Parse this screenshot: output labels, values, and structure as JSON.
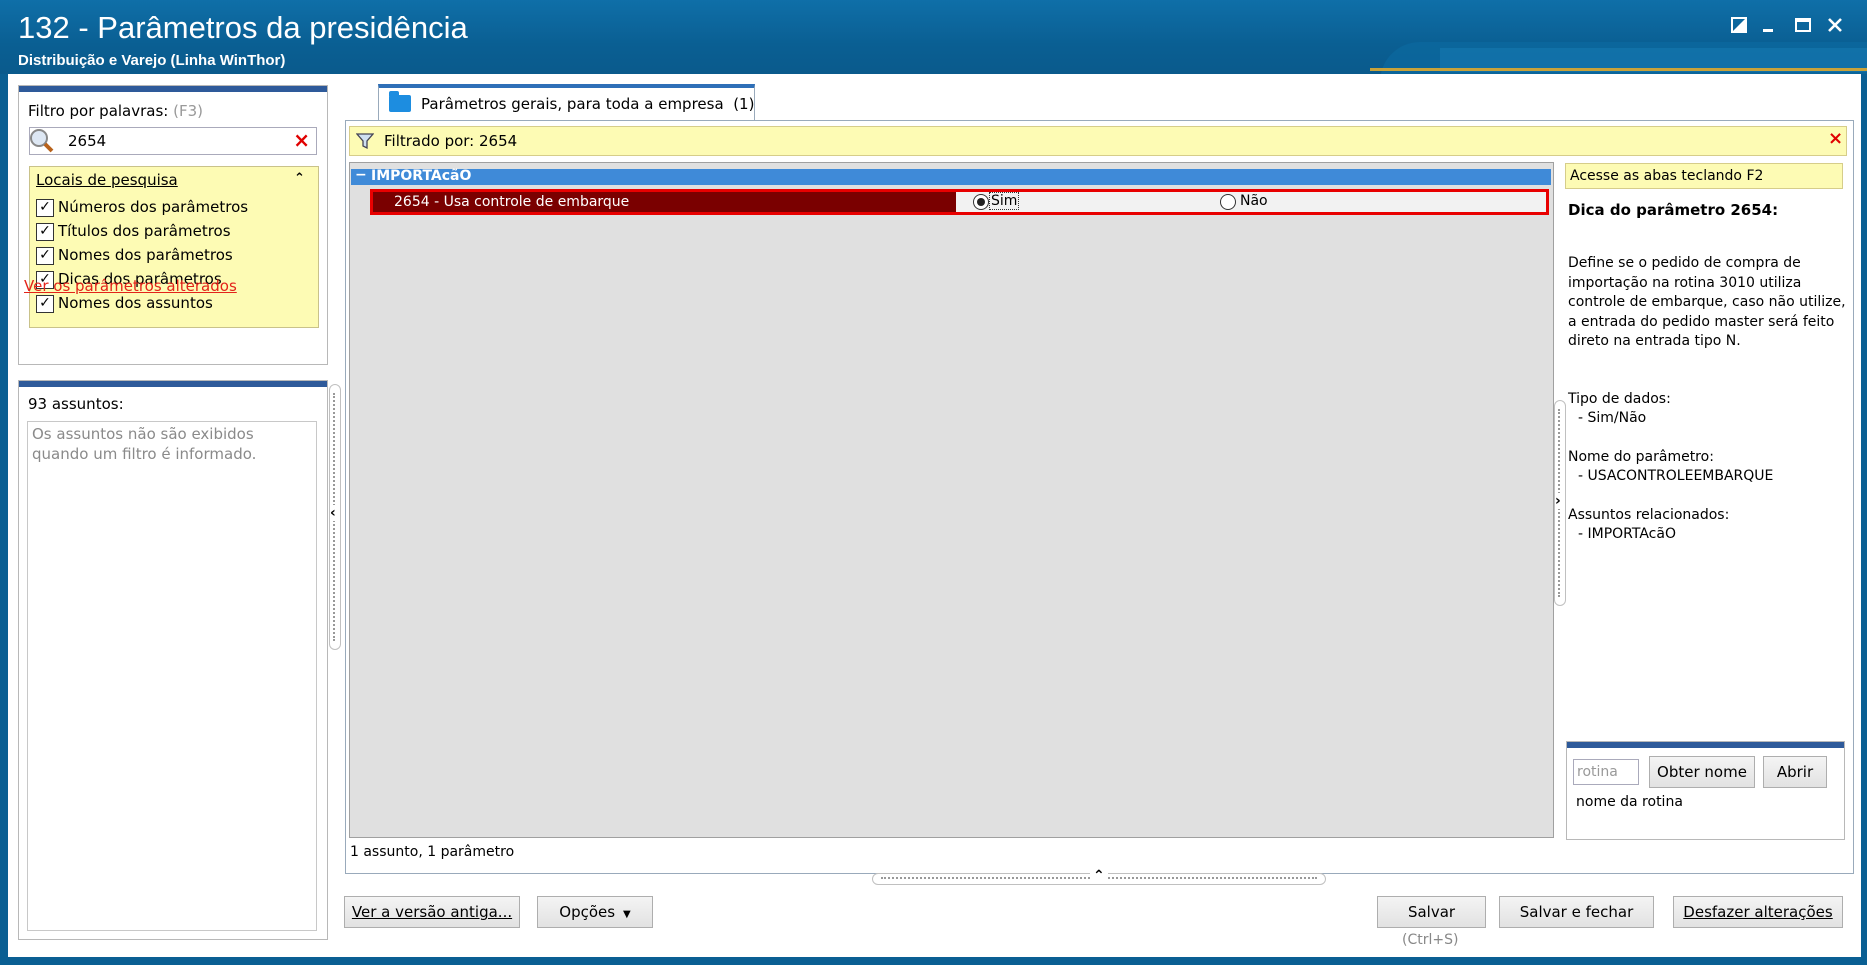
{
  "window": {
    "title": "132 - Parâmetros da presidência",
    "subtitle": "Distribuição e Varejo (Linha WinThor)",
    "icons": [
      "restore-icon",
      "minimize-icon",
      "maximize-icon",
      "close-icon"
    ]
  },
  "filter": {
    "label": "Filtro por palavras:",
    "shortcut": "(F3)",
    "value": "2654",
    "clear_icon": "×",
    "locais_title": "Locais de pesquisa",
    "options": [
      {
        "label": "Números dos parâmetros",
        "checked": true
      },
      {
        "label": "Títulos dos parâmetros",
        "checked": true
      },
      {
        "label": "Nomes dos parâmetros",
        "checked": true
      },
      {
        "label": "Dicas dos parâmetros",
        "checked": true
      },
      {
        "label": "Nomes dos assuntos",
        "checked": true
      }
    ],
    "changed_link": "Ver os parâmetros alterados"
  },
  "subjects": {
    "count_label": "93 assuntos:",
    "message": "Os assuntos não são exibidos quando um filtro é informado."
  },
  "tab": {
    "label": "Parâmetros gerais, para toda a empresa",
    "count": "(1)"
  },
  "filtered": {
    "label": "Filtrado por: 2654",
    "close": "×"
  },
  "grid": {
    "group": "IMPORTAcãO",
    "group_toggle": "−",
    "row": {
      "name": "2654 - Usa controle de embarque",
      "option_yes": "Sim",
      "option_no": "Não",
      "selected": "Sim"
    },
    "status": "1 assunto, 1 parâmetro"
  },
  "hint": {
    "tab_tip": "Acesse as abas teclando F2",
    "title": "Dica do parâmetro 2654:",
    "description": "Define se o pedido de compra de importação na rotina  3010 utiliza controle de embarque, caso não utilize, a entrada do pedido master será feito direto na entrada tipo N.",
    "data_type_label": "Tipo de dados:",
    "data_type_value": "- Sim/Não",
    "name_label": "Nome do parâmetro:",
    "name_value": "- USACONTROLEEMBARQUE",
    "subjects_label": "Assuntos relacionados:",
    "subjects_value": "- IMPORTAcãO"
  },
  "routine_tools": {
    "placeholder": "rotina",
    "get_name": "Obter nome",
    "open": "Abrir",
    "name_label": "nome da rotina"
  },
  "footer": {
    "old_version": "Ver a versão antiga...",
    "options": "Opções",
    "save": "Salvar",
    "save_shortcut": "(Ctrl+S)",
    "save_close": "Salvar e fechar",
    "undo": "Desfazer alterações"
  }
}
